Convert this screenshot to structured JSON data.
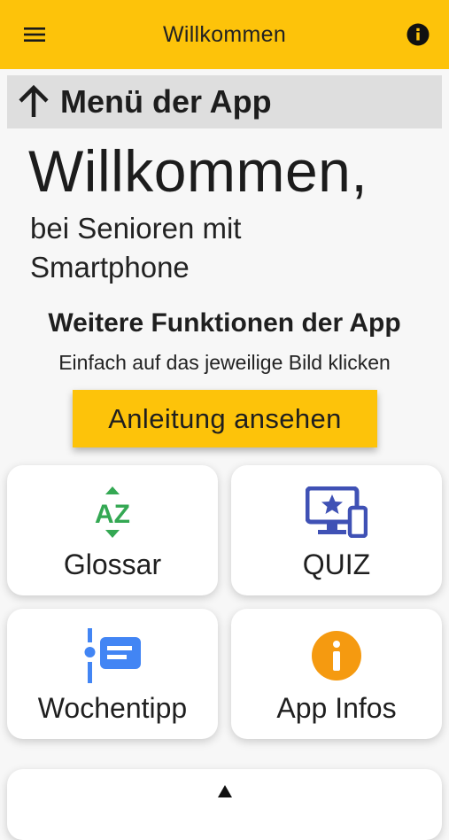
{
  "appbar": {
    "title": "Willkommen",
    "menu_icon": "hamburger-menu-icon",
    "info_icon": "info-circle-icon"
  },
  "menu_banner": {
    "icon": "arrow-up-icon",
    "label": "Menü der App"
  },
  "welcome": {
    "title": "Willkommen,",
    "subtitle": "bei Senioren mit Smartphone"
  },
  "functions": {
    "heading": "Weitere Funktionen der App",
    "hint": "Einfach auf das jeweilige Bild klicken",
    "guide_button": "Anleitung ansehen"
  },
  "cards": [
    {
      "label": "Glossar",
      "icon": "az-sort-icon",
      "color": "#34a853"
    },
    {
      "label": "QUIZ",
      "icon": "monitor-star-icon",
      "color": "#3f51b5"
    },
    {
      "label": "Wochentipp",
      "icon": "timeline-note-icon",
      "color": "#4285f4"
    },
    {
      "label": "App Infos",
      "icon": "info-circle-icon",
      "color": "#f59a10"
    }
  ],
  "colors": {
    "accent": "#fdc30a",
    "background": "#f7f7f7",
    "banner": "#dedede"
  }
}
